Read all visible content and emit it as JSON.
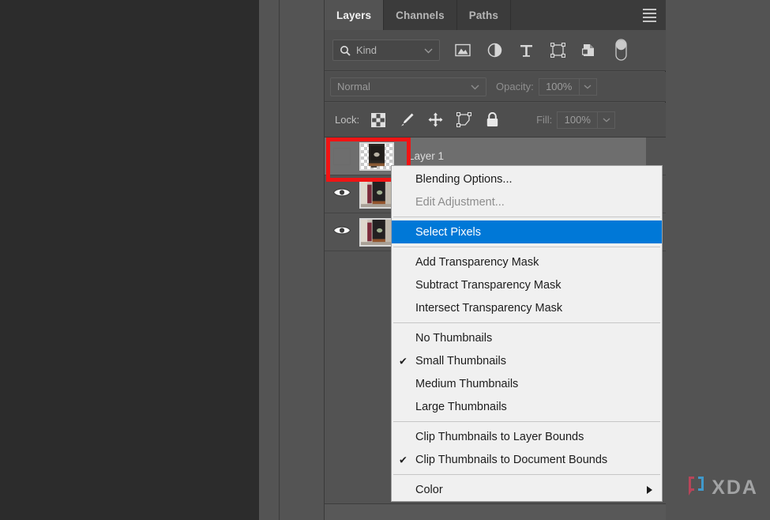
{
  "panel": {
    "tabs": [
      {
        "label": "Layers",
        "active": true
      },
      {
        "label": "Channels",
        "active": false
      },
      {
        "label": "Paths",
        "active": false
      }
    ],
    "menu_icon": "hamburger-menu-icon",
    "filter": {
      "search_icon": "search-icon",
      "kind_label": "Kind",
      "dropdown_icon": "chevron-down-icon",
      "icons": [
        "image-filter-icon",
        "adjustment-filter-icon",
        "type-filter-icon",
        "shape-filter-icon",
        "smart-object-filter-icon",
        "filter-toggle-switch-icon"
      ]
    },
    "blend": {
      "mode": "Normal",
      "mode_dropdown_icon": "chevron-down-icon",
      "opacity_label": "Opacity:",
      "opacity_value": "100%",
      "opacity_stepper_icon": "chevron-down-icon"
    },
    "lock": {
      "label": "Lock:",
      "icons": [
        "lock-transparent-pixels-icon",
        "lock-image-pixels-icon",
        "lock-position-icon",
        "lock-artboard-nesting-icon",
        "lock-all-icon"
      ],
      "fill_label": "Fill:",
      "fill_value": "100%",
      "fill_stepper_icon": "chevron-down-icon"
    },
    "layers": [
      {
        "name": "Layer 1",
        "visible": false,
        "selected": true,
        "visibility_icon": "eye-icon-hidden",
        "thumbnail": "layer-thumbnail-transparent"
      },
      {
        "name": "",
        "visible": true,
        "selected": false,
        "visibility_icon": "eye-icon",
        "thumbnail": "layer-thumbnail-photo"
      },
      {
        "name": "",
        "visible": true,
        "selected": false,
        "visibility_icon": "eye-icon",
        "thumbnail": "layer-thumbnail-photo"
      }
    ]
  },
  "annotation": {
    "highlight_color": "#f01414",
    "name": "red-highlight-rectangle"
  },
  "context_menu": {
    "groups": [
      {
        "items": [
          {
            "label": "Blending Options...",
            "state": "normal",
            "checked": false,
            "submenu": false
          },
          {
            "label": "Edit Adjustment...",
            "state": "disabled",
            "checked": false,
            "submenu": false
          }
        ]
      },
      {
        "items": [
          {
            "label": "Select Pixels",
            "state": "selected",
            "checked": false,
            "submenu": false
          }
        ]
      },
      {
        "items": [
          {
            "label": "Add Transparency Mask",
            "state": "normal",
            "checked": false,
            "submenu": false
          },
          {
            "label": "Subtract Transparency Mask",
            "state": "normal",
            "checked": false,
            "submenu": false
          },
          {
            "label": "Intersect Transparency Mask",
            "state": "normal",
            "checked": false,
            "submenu": false
          }
        ]
      },
      {
        "items": [
          {
            "label": "No Thumbnails",
            "state": "normal",
            "checked": false,
            "submenu": false
          },
          {
            "label": "Small Thumbnails",
            "state": "normal",
            "checked": true,
            "submenu": false
          },
          {
            "label": "Medium Thumbnails",
            "state": "normal",
            "checked": false,
            "submenu": false
          },
          {
            "label": "Large Thumbnails",
            "state": "normal",
            "checked": false,
            "submenu": false
          }
        ]
      },
      {
        "items": [
          {
            "label": "Clip Thumbnails to Layer Bounds",
            "state": "normal",
            "checked": false,
            "submenu": false
          },
          {
            "label": "Clip Thumbnails to Document Bounds",
            "state": "normal",
            "checked": true,
            "submenu": false
          }
        ]
      },
      {
        "items": [
          {
            "label": "Color",
            "state": "normal",
            "checked": false,
            "submenu": true
          }
        ]
      }
    ],
    "checkmark_glyph": "✔",
    "submenu_arrow_icon": "triangle-right-icon",
    "highlight_color": "#0078d7"
  },
  "watermark": {
    "wordmark": "XDA",
    "bracket_icon": "xda-bracket-logo-icon",
    "bracket_left_color": "#c0445a",
    "bracket_right_color": "#3f9fd6"
  }
}
